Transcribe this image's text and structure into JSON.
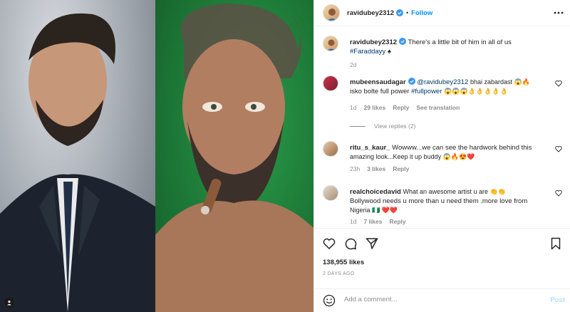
{
  "header": {
    "username": "ravidubey2312",
    "separator": "•",
    "follow_label": "Follow"
  },
  "caption": {
    "username": "ravidubey2312",
    "text": "There's a little bit of him in all of us",
    "hashtag": "#Faraddayy",
    "suffix": "♠",
    "time": "2d"
  },
  "comments": [
    {
      "username": "mubeensaudagar",
      "mention": "@ravidubey2312",
      "text": "bhai zabardast 😱🔥",
      "line2_prefix": "isko bolte full power",
      "line2_hashtag": "#fullpower",
      "line2_suffix": "😱😱😱👌👌👌👌👌",
      "time": "1d",
      "likes": "29 likes",
      "reply": "Reply",
      "translate": "See translation",
      "view_replies": "View replies (2)"
    },
    {
      "username": "ritu_s_kaur_",
      "text": "Wowww...we can see the hardwork behind this",
      "line2": "amazing look...Keep it up buddy 😱🔥😍❤️",
      "time": "23h",
      "likes": "3 likes",
      "reply": "Reply"
    },
    {
      "username": "realchoicedavid",
      "text": "What an awesome artist u are 👏👏",
      "line2": "Bollywood needs u more than u need them .more love from",
      "line3": "Nigeria 🇳🇬 ❤️❤️",
      "time": "1d",
      "likes": "7 likes",
      "reply": "Reply"
    }
  ],
  "stats": {
    "likes": "138,955 likes",
    "posted": "2 DAYS AGO"
  },
  "add_comment": {
    "placeholder": "Add a comment...",
    "post_label": "Post"
  },
  "colors": {
    "accent": "#0095f6",
    "muted": "#8e8e8e",
    "link": "#00376b",
    "like_red": "#ed4956"
  }
}
